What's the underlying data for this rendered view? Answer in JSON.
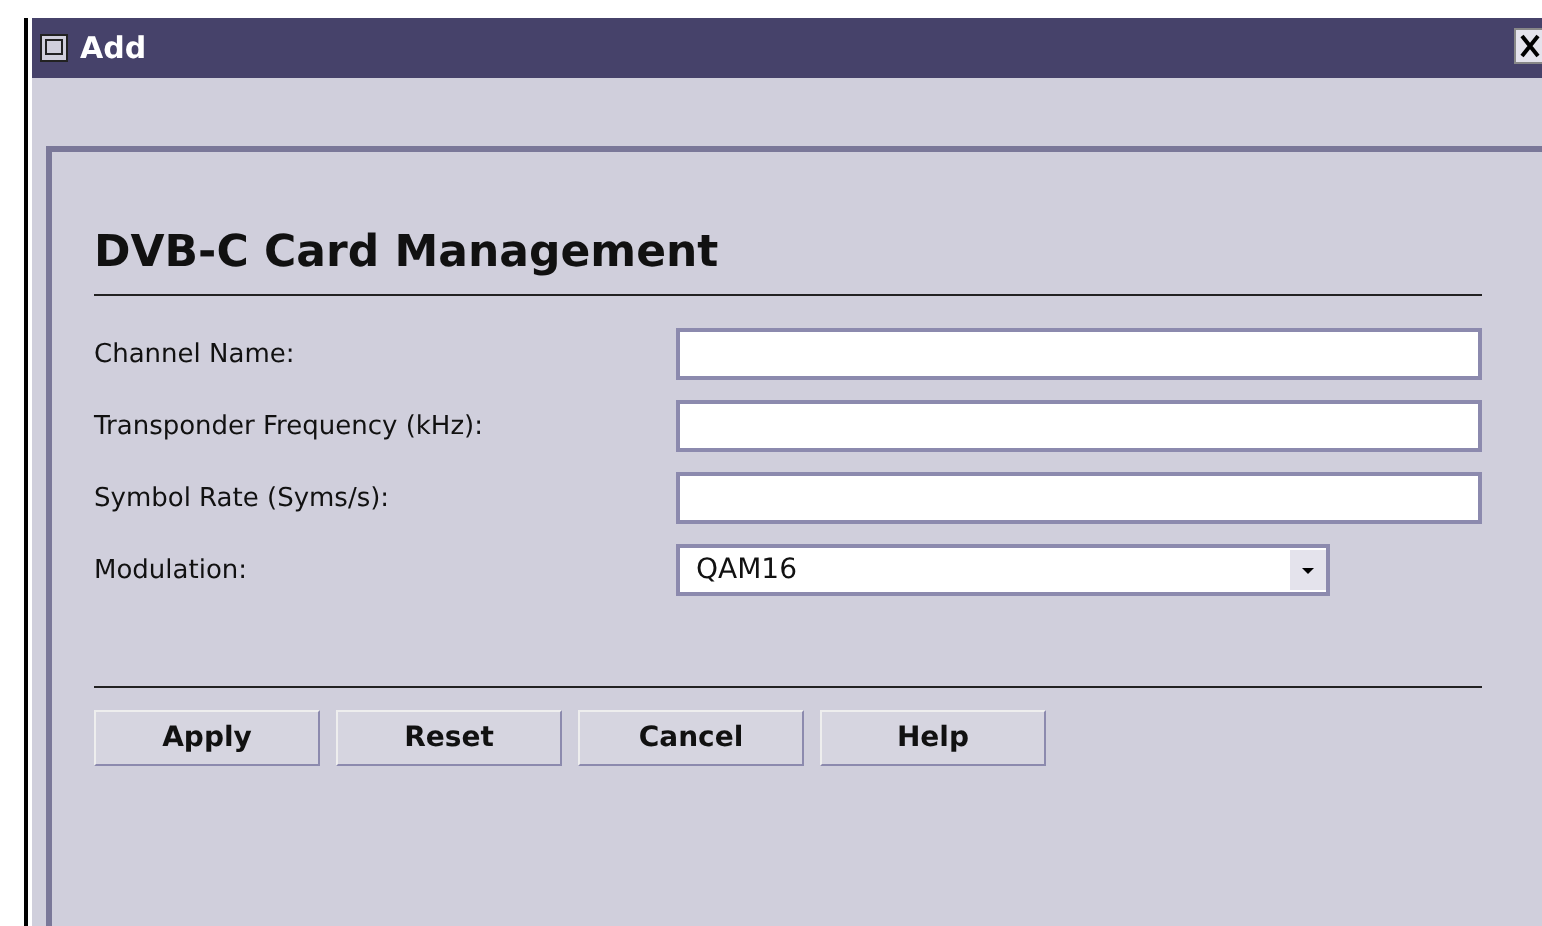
{
  "window": {
    "title": "Add"
  },
  "heading": "DVB-C Card Management",
  "fields": [
    {
      "kind": "text",
      "label": "Channel Name:"
    },
    {
      "kind": "text",
      "label": "Transponder Frequency (kHz):"
    },
    {
      "kind": "text",
      "label": "Symbol Rate (Syms/s):"
    },
    {
      "kind": "select",
      "label": "Modulation:",
      "value": "QAM16"
    }
  ],
  "buttons": [
    "Apply",
    "Reset",
    "Cancel",
    "Help"
  ]
}
